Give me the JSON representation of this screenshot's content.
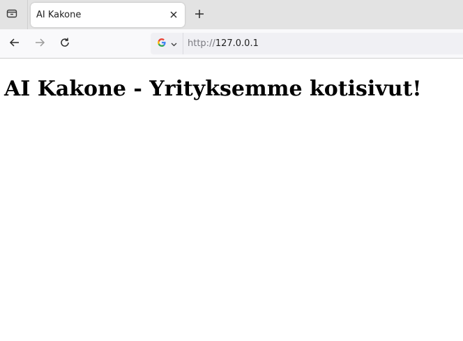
{
  "browser": {
    "tab": {
      "title": "AI Kakone"
    },
    "address_bar": {
      "scheme": "http://",
      "host": "127.0.0.1"
    },
    "search_engine_icon": "google-g-icon",
    "icons": {
      "tab_list": "tab-list-icon",
      "close": "close-icon",
      "new_tab": "plus-icon",
      "back": "arrow-left-icon",
      "forward": "arrow-right-icon",
      "reload": "reload-icon"
    }
  },
  "page": {
    "heading": "AI Kakone - Yrityksemme kotisivut!"
  },
  "colors": {
    "tabbar_bg": "#e3e3e3",
    "toolbar_bg": "#f9f9fb",
    "urlbar_bg": "#f0f0f4",
    "page_bg": "#ffffff"
  }
}
